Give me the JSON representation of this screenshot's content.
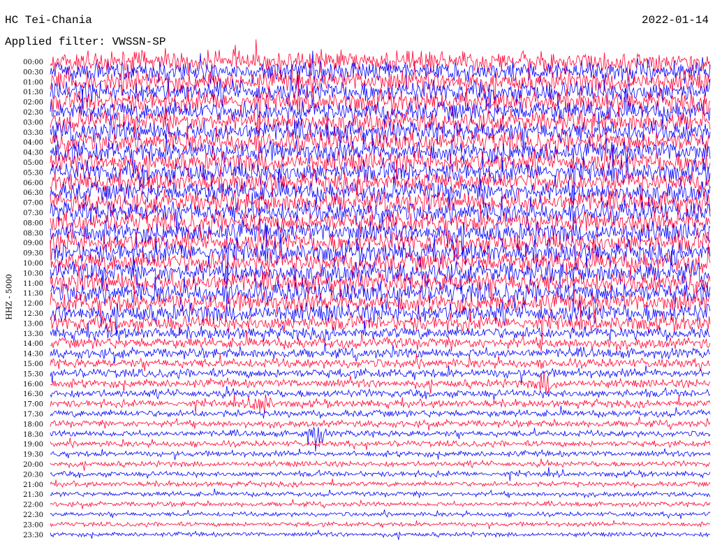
{
  "header": {
    "station": "HC Tei-Chania",
    "filter": "Applied filter: VWSSN-SP",
    "date": "2022-01-14"
  },
  "channel_label": "HHZ - 5000",
  "colors": {
    "even": "#ff0033",
    "odd": "#0000ff",
    "background": "#ffffff"
  },
  "chart_data": {
    "type": "line",
    "title": "HC Tei-Chania",
    "trace_count": 48,
    "row_labels": [
      "00:00",
      "00:30",
      "01:00",
      "01:30",
      "02:00",
      "02:30",
      "03:00",
      "03:30",
      "04:00",
      "04:30",
      "05:00",
      "05:30",
      "06:00",
      "06:30",
      "07:00",
      "07:30",
      "08:00",
      "08:30",
      "09:00",
      "09:30",
      "10:00",
      "10:30",
      "11:00",
      "11:30",
      "12:00",
      "12:30",
      "13:00",
      "13:30",
      "14:00",
      "14:30",
      "15:00",
      "15:30",
      "16:00",
      "16:30",
      "17:00",
      "17:30",
      "18:00",
      "18:30",
      "19:00",
      "19:30",
      "20:00",
      "20:30",
      "21:00",
      "21:30",
      "22:00",
      "22:30",
      "23:00",
      "23:30"
    ],
    "noise_amplitude": [
      0.95,
      0.95,
      0.95,
      0.95,
      0.95,
      0.95,
      0.95,
      0.95,
      0.95,
      0.95,
      0.95,
      0.95,
      0.95,
      0.95,
      0.95,
      0.95,
      0.95,
      0.95,
      0.95,
      0.95,
      0.95,
      0.95,
      0.95,
      0.95,
      0.9,
      0.85,
      0.7,
      0.55,
      0.5,
      0.45,
      0.42,
      0.4,
      0.38,
      0.35,
      0.33,
      0.32,
      0.3,
      0.28,
      0.27,
      0.26,
      0.25,
      0.24,
      0.23,
      0.22,
      0.21,
      0.2,
      0.2,
      0.2
    ],
    "events": [
      {
        "row": 34,
        "x_fraction": 0.32,
        "amplitude": 1.0
      },
      {
        "row": 37,
        "x_fraction": 0.4,
        "amplitude": 1.0
      },
      {
        "row": 32,
        "x_fraction": 0.75,
        "amplitude": 0.8
      }
    ]
  }
}
